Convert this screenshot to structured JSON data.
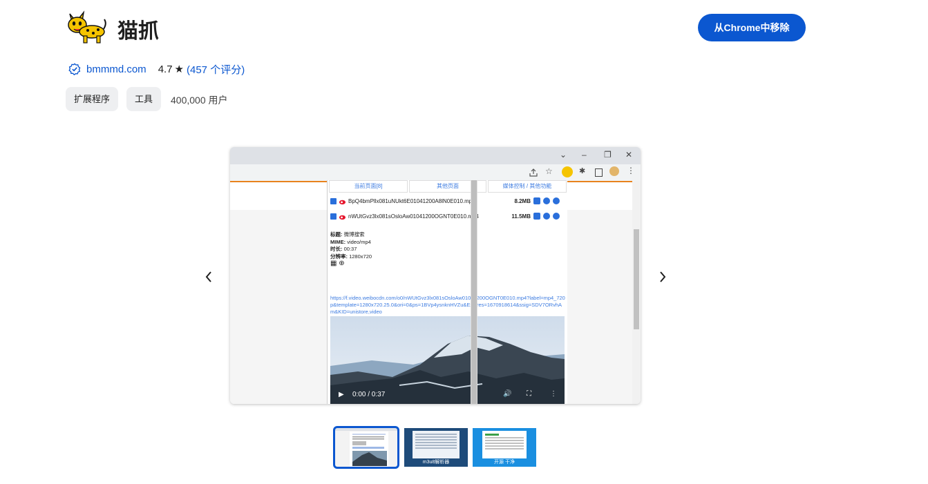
{
  "extension": {
    "name": "猫抓",
    "remove_button_label": "从Chrome中移除",
    "site": "bmmmd.com",
    "rating": "4.7",
    "rating_count_link": "(457 个评分)",
    "chips": [
      "扩展程序",
      "工具"
    ],
    "users": "400,000 用户"
  },
  "icons": {
    "logo": "cat-logo-icon",
    "verified": "verified-badge-icon",
    "star": "star-icon",
    "prev": "chevron-left-icon",
    "next": "chevron-right-icon"
  },
  "colors": {
    "primary_blue": "#0b57d0",
    "chip_bg": "#eeeff1",
    "accent_orange": "#e8821c"
  },
  "screenshot": {
    "popup_tabs": [
      "当前页面[8]",
      "其他页面",
      "媒体控制 / 其他功能"
    ],
    "files": [
      {
        "name": "BpQ4bmPllx081uNUkt6E01041200A8lN0E010.mp4",
        "size": "8.2MB"
      },
      {
        "name": "nWUtGvz3lx081sOsloAw01041200OGNT0E010.mp4",
        "size": "11.5MB"
      }
    ],
    "info": {
      "title_label": "标题:",
      "title_value": "微博搜索",
      "mime_label": "MIME:",
      "mime_value": "video/mp4",
      "duration_label": "时长:",
      "duration_value": "00:37",
      "resolution_label": "分辨率:",
      "resolution_value": "1280x720"
    },
    "url": "https://f.video.weibocdn.com/o0/nWUtGvz3lx081sOsloAw01041200OGNT0E010.mp4?label=mp4_720p&template=1280x720.25.0&ori=0&ps=1BVp4ysnknHVZu&Expires=1670918614&ssig=SDV7ORvhAm&KID=unistore,video",
    "video_time": "0:00 / 0:37"
  },
  "thumbnails": [
    {
      "caption": ""
    },
    {
      "caption": "m3u8解析器"
    },
    {
      "caption": "开源 干净"
    }
  ]
}
